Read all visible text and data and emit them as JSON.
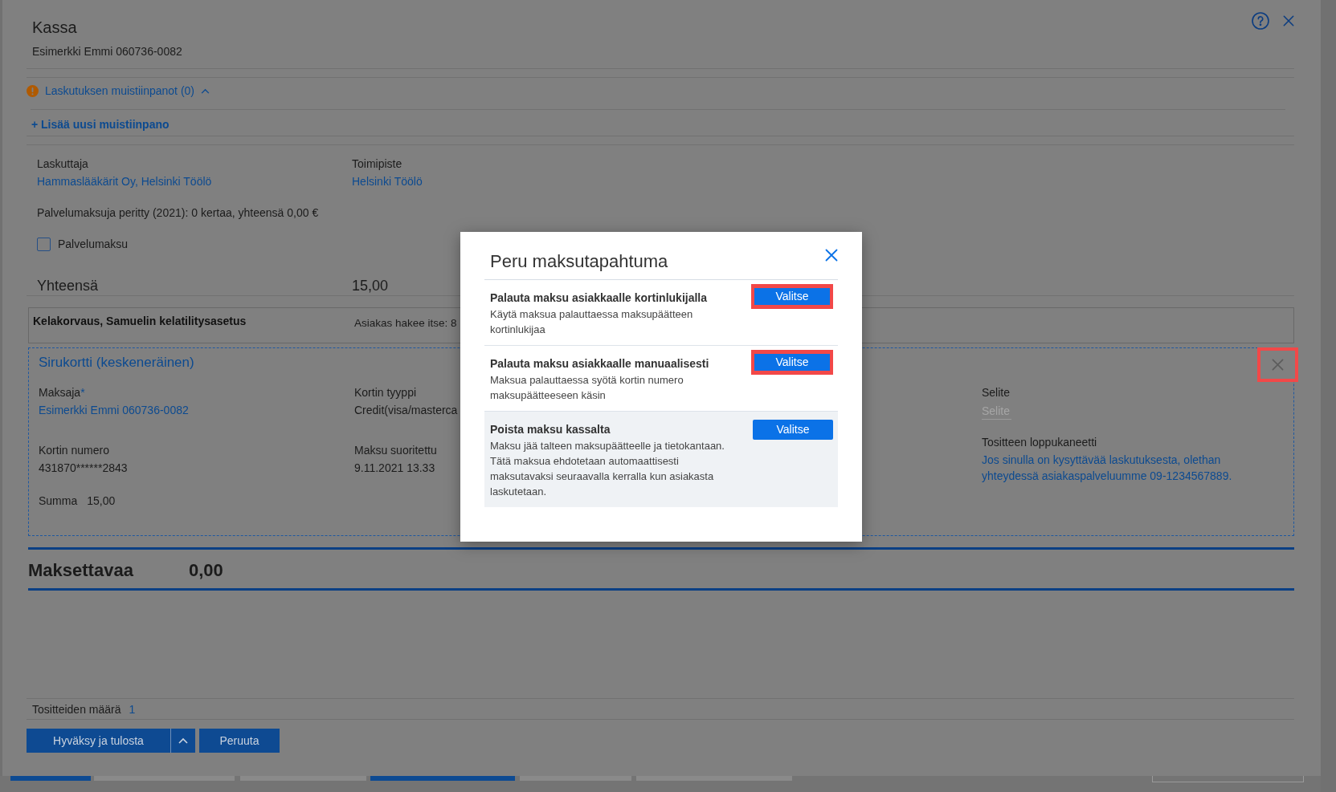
{
  "window": {
    "title": "Kassa",
    "subtitle": "Esimerkki Emmi 060736-0082"
  },
  "notes": {
    "label": "Laskutuksen muistiinpanot (0)",
    "expanded": true,
    "add_link": "+ Lisää uusi muistiinpano"
  },
  "billing_fields": [
    {
      "label": "Laskuttaja",
      "value": "Hammaslääkärit Oy, Helsinki Töölö"
    },
    {
      "label": "Toimipiste",
      "value": "Helsinki Töölö"
    }
  ],
  "service_fee_summary": "Palvelumaksuja peritty (2021): 0 kertaa, yhteensä 0,00 €",
  "service_fee_checkbox": {
    "label": "Palvelumaksu",
    "checked": false
  },
  "total": {
    "label": "Yhteensä",
    "value": "15,00"
  },
  "reimbursement": {
    "title": "Kelakorvaus, Samuelin kelatilitysasetus",
    "info": "Asiakas hakee itse: 8"
  },
  "payment": {
    "title": "Sirukortti (keskeneräinen)",
    "remove_highlighted": true,
    "payer": {
      "label": "Maksaja",
      "required_mark": "*",
      "value": "Esimerkki Emmi 060736-0082"
    },
    "card_type": {
      "label": "Kortin tyyppi",
      "value": "Credit(visa/masterca"
    },
    "card_number": {
      "label": "Kortin numero",
      "value": "431870******2843"
    },
    "paid_at": {
      "label": "Maksu suoritettu",
      "value": "9.11.2021 13.33"
    },
    "sum": {
      "label": "Summa",
      "value": "15,00"
    },
    "description": {
      "label": "Selite",
      "placeholder": "Selite"
    },
    "receipt_note": {
      "label": "Tositteen loppukaneetti",
      "value": "Jos sinulla on kysyttävää laskutuksesta, olethan yhteydessä asiakaspalveluumme 09-1234567889."
    }
  },
  "amount_due": {
    "label": "Maksettavaa",
    "value": "0,00"
  },
  "receipt_count": {
    "label": "Tositteiden määrä",
    "value": "1"
  },
  "actions": {
    "primary": "Hyväksy ja tulosta",
    "secondary": "Peruuta"
  },
  "modal": {
    "title": "Peru maksutapahtuma",
    "options": [
      {
        "title": "Palauta maksu asiakkaalle kortinlukijalla",
        "description": "Käytä maksua palauttaessa maksupäätteen kortinlukijaa",
        "button": "Valitse",
        "highlighted": true,
        "selected": false
      },
      {
        "title": "Palauta maksu asiakkaalle manuaalisesti",
        "description": "Maksua palauttaessa syötä kortin numero maksupäätteeseen käsin",
        "button": "Valitse",
        "highlighted": true,
        "selected": false
      },
      {
        "title": "Poista maksu kassalta",
        "description": "Maksu jää talteen maksupäätteelle ja tietokantaan. Tätä maksua ehdotetaan automaattisesti maksutavaksi seuraavalla kerralla kun asiakasta laskutetaan.",
        "button": "Valitse",
        "highlighted": false,
        "selected": true
      }
    ]
  }
}
